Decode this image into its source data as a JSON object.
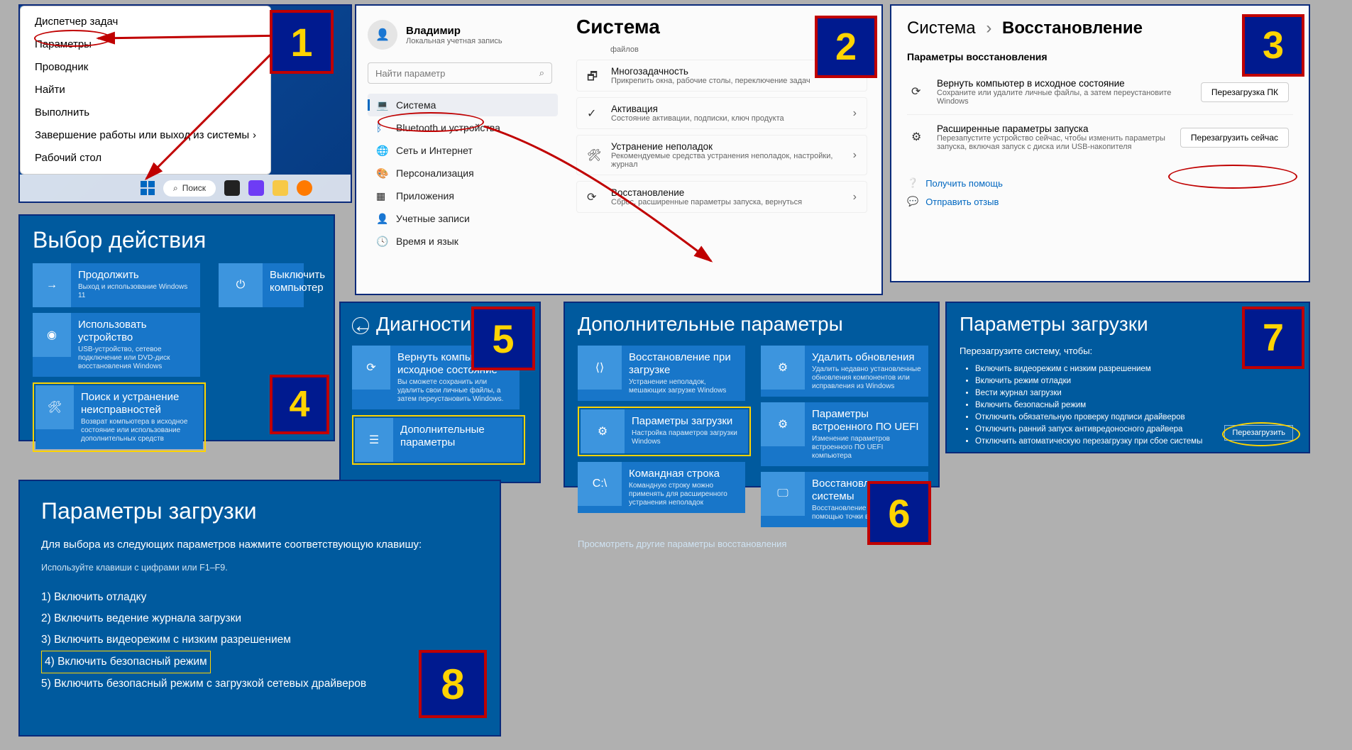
{
  "panel1": {
    "menu": [
      "Диспетчер задач",
      "Параметры",
      "Проводник",
      "Найти",
      "Выполнить",
      "Завершение работы или выход из системы",
      "Рабочий стол"
    ],
    "search_label": "Поиск"
  },
  "panel2": {
    "user_name": "Владимир",
    "user_desc": "Локальная учетная запись",
    "search_placeholder": "Найти параметр",
    "nav": [
      {
        "icon": "system",
        "label": "Система",
        "selected": true
      },
      {
        "icon": "bluetooth",
        "label": "Bluetooth и устройства"
      },
      {
        "icon": "network",
        "label": "Сеть и Интернет"
      },
      {
        "icon": "personalization",
        "label": "Персонализация"
      },
      {
        "icon": "apps",
        "label": "Приложения"
      },
      {
        "icon": "accounts",
        "label": "Учетные записи"
      },
      {
        "icon": "time",
        "label": "Время и язык"
      }
    ],
    "heading": "Система",
    "partial_desc": "файлов",
    "cards": [
      {
        "title": "Многозадачность",
        "desc": "Прикрепить окна, рабочие столы, переключение задач"
      },
      {
        "title": "Активация",
        "desc": "Состояние активации, подписки, ключ продукта"
      },
      {
        "title": "Устранение неполадок",
        "desc": "Рекомендуемые средства устранения неполадок, настройки, журнал"
      },
      {
        "title": "Восстановление",
        "desc": "Сброс, расширенные параметры запуска, вернуться"
      }
    ]
  },
  "panel3": {
    "crumb_root": "Система",
    "crumb_leaf": "Восстановление",
    "section": "Параметры восстановления",
    "rows": [
      {
        "title": "Вернуть компьютер в исходное состояние",
        "desc": "Сохраните или удалите личные файлы, а затем переустановите Windows",
        "button": "Перезагрузка ПК"
      },
      {
        "title": "Расширенные параметры запуска",
        "desc": "Перезапустите устройство сейчас, чтобы изменить параметры запуска, включая запуск с диска или USB-накопителя",
        "button": "Перезагрузить сейчас"
      }
    ],
    "help_link": "Получить помощь",
    "feedback_link": "Отправить отзыв"
  },
  "panel4": {
    "heading": "Выбор действия",
    "tiles_left": [
      {
        "title": "Продолжить",
        "desc": "Выход и использование Windows 11"
      },
      {
        "title": "Использовать устройство",
        "desc": "USB-устройство, сетевое подключение или DVD-диск восстановления Windows"
      },
      {
        "title": "Поиск и устранение неисправностей",
        "desc": "Возврат компьютера в исходное состояние или использование дополнительных средств"
      }
    ],
    "tiles_right": [
      {
        "title": "Выключить компьютер",
        "desc": ""
      }
    ]
  },
  "panel5": {
    "heading": "Диагностика",
    "tiles": [
      {
        "title": "Вернуть компьютер в исходное состояние",
        "desc": "Вы сможете сохранить или удалить свои личные файлы, а затем переустановить Windows."
      },
      {
        "title": "Дополнительные параметры",
        "desc": ""
      }
    ]
  },
  "panel6": {
    "heading": "Дополнительные параметры",
    "left": [
      {
        "title": "Восстановление при загрузке",
        "desc": "Устранение неполадок, мешающих загрузке Windows"
      },
      {
        "title": "Параметры загрузки",
        "desc": "Настройка параметров загрузки Windows"
      },
      {
        "title": "Командная строка",
        "desc": "Командную строку можно применять для расширенного устранения неполадок"
      }
    ],
    "right": [
      {
        "title": "Удалить обновления",
        "desc": "Удалить недавно установленные обновления компонентов или исправления из Windows"
      },
      {
        "title": "Параметры встроенного ПО UEFI",
        "desc": "Изменение параметров встроенного ПО UEFI компьютера"
      },
      {
        "title": "Восстановление системы",
        "desc": "Восстановление Windows с помощью точки восстановления"
      }
    ],
    "more": "Просмотреть другие параметры восстановления"
  },
  "panel7": {
    "heading": "Параметры загрузки",
    "sub": "Перезагрузите систему, чтобы:",
    "items": [
      "Включить видеорежим с низким разрешением",
      "Включить режим отладки",
      "Вести журнал загрузки",
      "Включить безопасный режим",
      "Отключить обязательную проверку подписи драйверов",
      "Отключить ранний запуск антивредоносного драйвера",
      "Отключить автоматическую перезагрузку при сбое системы"
    ],
    "button": "Перезагрузить"
  },
  "panel8": {
    "heading": "Параметры загрузки",
    "lead": "Для выбора из следующих параметров нажмите соответствующую клавишу:",
    "hint": "Используйте клавиши с цифрами или F1–F9.",
    "items": [
      "1) Включить отладку",
      "2) Включить ведение журнала загрузки",
      "3) Включить видеорежим с низким разрешением",
      "4) Включить безопасный режим",
      "5) Включить безопасный режим с загрузкой сетевых драйверов"
    ]
  },
  "badges": {
    "b1": "1",
    "b2": "2",
    "b3": "3",
    "b4": "4",
    "b5": "5",
    "b6": "6",
    "b7": "7",
    "b8": "8"
  }
}
